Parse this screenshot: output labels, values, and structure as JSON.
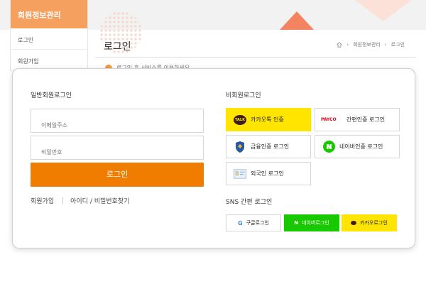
{
  "sidebar": {
    "title": "회원정보관리",
    "items": [
      {
        "label": "로그인"
      },
      {
        "label": "회원가입"
      }
    ]
  },
  "page": {
    "title": "로그인",
    "breadcrumb": [
      "회원정보관리",
      "로그인"
    ],
    "notice": "로그인 후 서비스를 이용하세요."
  },
  "member_login": {
    "title": "일반회원로그인",
    "email_placeholder": "이메일주소",
    "password_placeholder": "비밀번호",
    "login_label": "로그인",
    "signup_link": "회원가입",
    "find_link": "아이디 / 비밀번호찾기"
  },
  "guest_login": {
    "title": "비회원로그인",
    "buttons": [
      {
        "label": "카카오톡 인증",
        "icon": "talk-icon",
        "brand": "TALK"
      },
      {
        "label": "간편인증 로그인",
        "icon": "payco-icon",
        "brand": "PAYCO"
      },
      {
        "label": "금융인증 로그인",
        "icon": "financial-shield-icon"
      },
      {
        "label": "네이버인증 로그인",
        "icon": "naver-n-icon"
      },
      {
        "label": "외국인 로그인",
        "icon": "foreigner-id-icon"
      }
    ]
  },
  "sns_login": {
    "title": "SNS 간편 로그인",
    "buttons": [
      {
        "label": "구글로그인",
        "icon": "google-g-icon",
        "glyph": "G"
      },
      {
        "label": "네이버로그인",
        "icon": "naver-n-icon",
        "glyph": "N"
      },
      {
        "label": "카카오로그인",
        "icon": "kakao-bubble-icon"
      }
    ]
  },
  "colors": {
    "primary": "#f07d00",
    "kakao": "#ffe500",
    "naver": "#19c900"
  }
}
